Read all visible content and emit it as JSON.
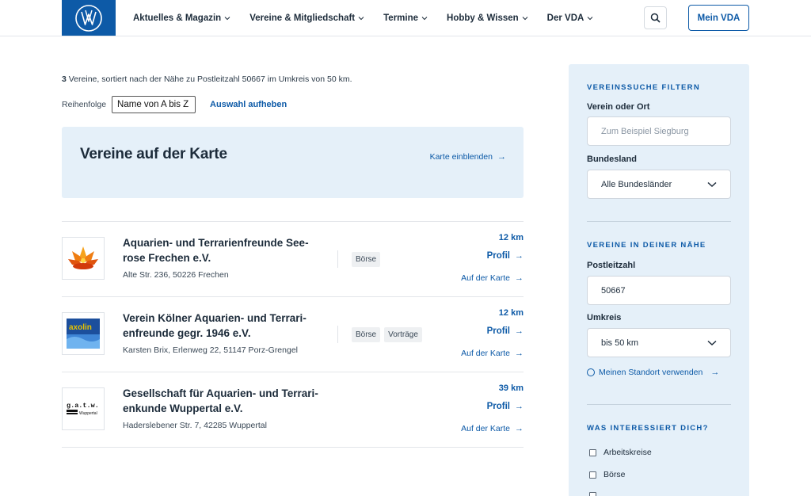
{
  "header": {
    "nav": [
      {
        "label": "Aktuelles & Magazin"
      },
      {
        "label": "Vereine & Mitgliedschaft"
      },
      {
        "label": "Termine"
      },
      {
        "label": "Hobby & Wissen"
      },
      {
        "label": "Der VDA"
      }
    ],
    "account_label": "Mein VDA",
    "search_icon": "search-icon",
    "brand_color": "#0d5aa7"
  },
  "results": {
    "count": "3",
    "summary_text": " Vereine, sortiert nach der Nähe zu Postleitzahl 50667 im Umkreis von 50 km.",
    "sort_label": "Reihenfolge",
    "sort_value": "Name von A bis Z",
    "clear_label": "Auswahl aufheben"
  },
  "map": {
    "title": "Vereine auf der Karte",
    "link_label": "Karte einblenden"
  },
  "clubs": [
    {
      "name": "Aquarien- und Terrarienfreunde See­rose Frechen e.V.",
      "address": "Alte Str. 236, 50226 Frechen",
      "tags": [
        "Börse"
      ],
      "distance": "12 km",
      "profile_label": "Profil",
      "map_label": "Auf der Karte"
    },
    {
      "name": "Verein Kölner Aquarien- und Terrari­enfreunde gegr. 1946 e.V.",
      "address": "Karsten Brix, Erlenweg 22, 51147 Porz-Grengel",
      "tags": [
        "Börse",
        "Vorträge"
      ],
      "distance": "12 km",
      "profile_label": "Profil",
      "map_label": "Auf der Karte",
      "logo_text": "axolin"
    },
    {
      "name": "Gesellschaft für Aquarien- und Terrari­enkunde Wuppertal e.V.",
      "address": "Haderslebener Str. 7, 42285 Wuppertal",
      "tags": [],
      "distance": "39 km",
      "profile_label": "Profil",
      "map_label": "Auf der Karte",
      "logo_text": "g.a.t.w.",
      "logo_subtext": "Wuppertal"
    }
  ],
  "sidebar": {
    "filter_title": "VEREINSSUCHE FILTERN",
    "club_label": "Verein oder Ort",
    "club_placeholder": "Zum Beispiel Siegburg",
    "state_label": "Bundesland",
    "state_value": "Alle Bundesländer",
    "nearby_title": "VEREINE IN DEINER NÄHE",
    "zip_label": "Postleitzahl",
    "zip_value": "50667",
    "radius_label": "Umkreis",
    "radius_value": "bis 50 km",
    "location_label": "Meinen Standort verwenden",
    "interest_title": "WAS INTERESSIERT DICH?",
    "interests": [
      "Arbeitskreise",
      "Börse"
    ]
  }
}
